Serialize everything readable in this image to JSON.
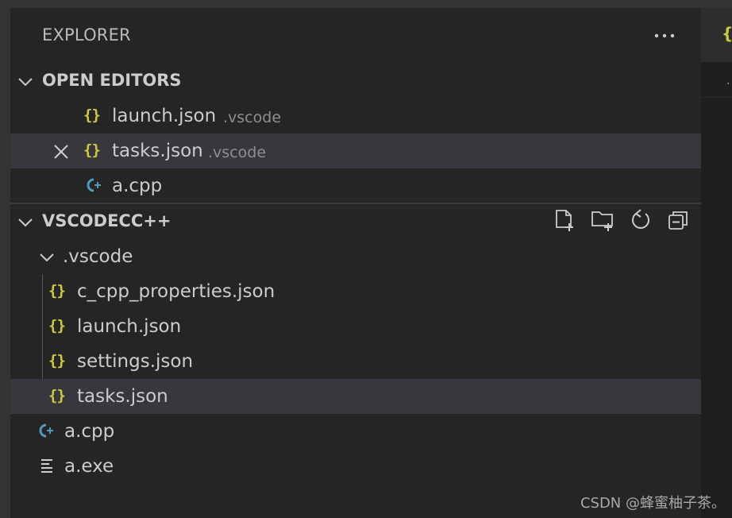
{
  "explorer": {
    "title": "EXPLORER",
    "more_icon": "ellipsis-icon"
  },
  "open_editors": {
    "header": "OPEN EDITORS",
    "items": [
      {
        "name": "launch.json",
        "folder": ".vscode",
        "icon": "json-icon"
      },
      {
        "name": "tasks.json",
        "folder": ".vscode",
        "icon": "json-icon",
        "close_icon": "close-icon"
      },
      {
        "name": "a.cpp",
        "icon": "cpp-icon"
      }
    ]
  },
  "workspace": {
    "header": "VSCODECC++",
    "actions": [
      "new-file-icon",
      "new-folder-icon",
      "refresh-icon",
      "collapse-all-icon"
    ],
    "folder": {
      "name": ".vscode"
    },
    "folder_files": [
      {
        "name": "c_cpp_properties.json",
        "icon": "json-icon"
      },
      {
        "name": "launch.json",
        "icon": "json-icon"
      },
      {
        "name": "settings.json",
        "icon": "json-icon"
      },
      {
        "name": "tasks.json",
        "icon": "json-icon"
      }
    ],
    "root_files": [
      {
        "name": "a.cpp",
        "icon": "cpp-icon"
      },
      {
        "name": "a.exe",
        "icon": "text-file-icon"
      }
    ]
  },
  "watermark": "CSDN @蜂蜜柚子茶。",
  "colors": {
    "json_icon": "#cbcb41",
    "cpp_icon": "#519aba",
    "selected_row": "#37373d",
    "sidebar_bg": "#252526"
  }
}
